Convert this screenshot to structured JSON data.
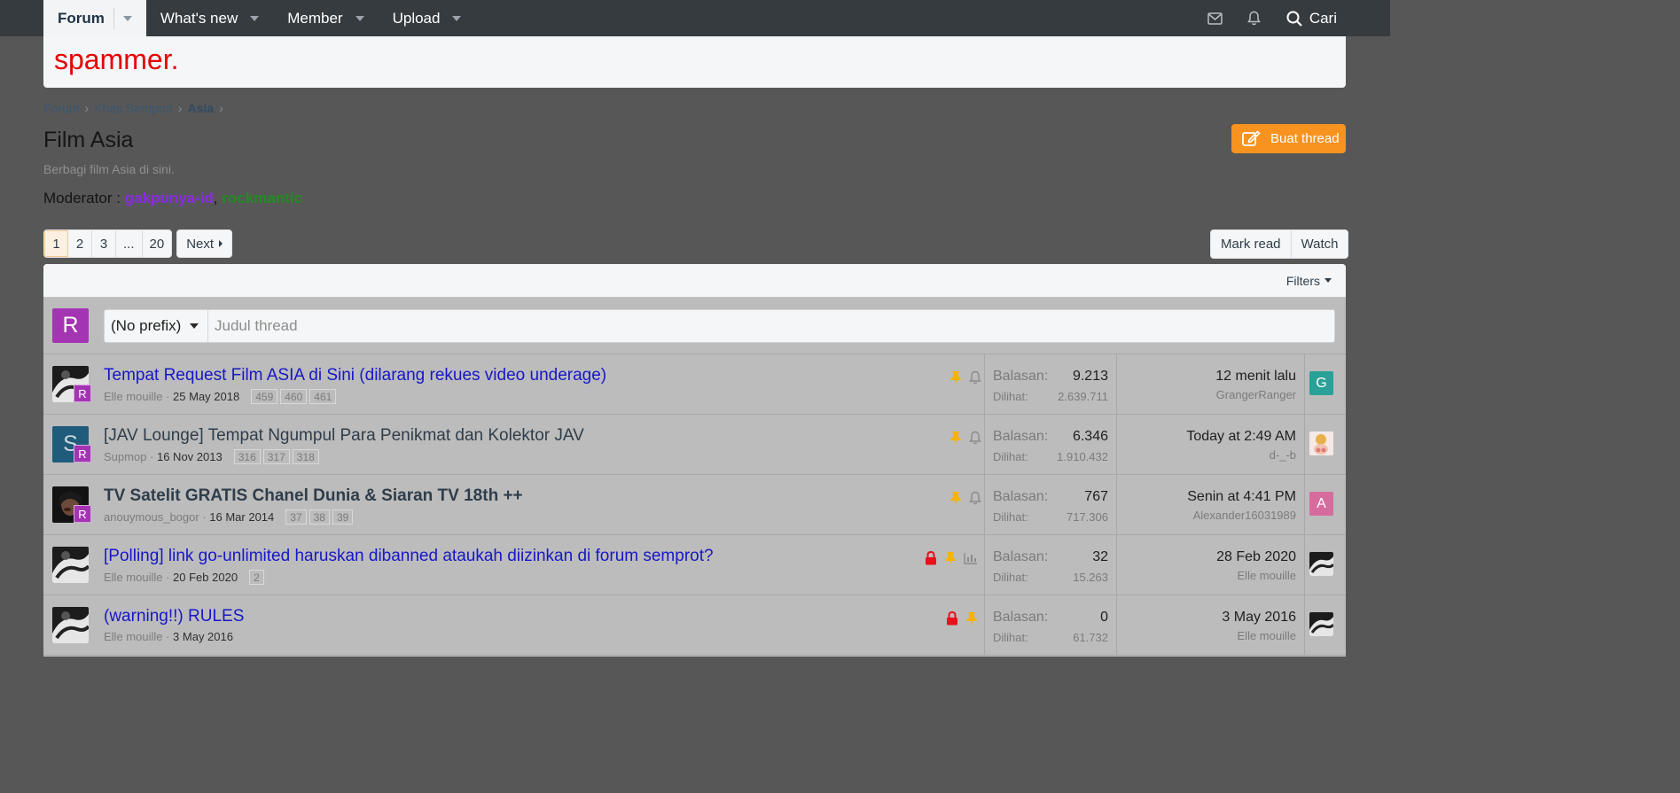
{
  "nav": {
    "tabs": [
      {
        "label": "Forum"
      },
      {
        "label": "What's new"
      },
      {
        "label": "Member"
      },
      {
        "label": "Upload"
      }
    ],
    "search_label": "Cari"
  },
  "notice": {
    "text": "spammer."
  },
  "breadcrumb": [
    "Forum",
    "Khas Semprot",
    "Asia"
  ],
  "page": {
    "title": "Film Asia",
    "description": "Berbagi film Asia di sini.",
    "moderator_label": "Moderator :",
    "moderators": [
      "gakpunya-id",
      "rockmantic"
    ],
    "create_button": "Buat thread"
  },
  "pagination": {
    "pages": [
      "1",
      "2",
      "3",
      "...",
      "20"
    ],
    "next": "Next"
  },
  "actions": {
    "mark_read": "Mark read",
    "watch": "Watch"
  },
  "filters_label": "Filters",
  "quick_thread": {
    "avatar_letter": "R",
    "prefix": "(No prefix)",
    "placeholder": "Judul thread"
  },
  "labels": {
    "replies": "Balasan:",
    "views": "Dilihat:"
  },
  "threads": [
    {
      "title": "Tempat Request Film ASIA di Sini (dilarang rekues video underage)",
      "author": "Elle mouille",
      "date": "25 May 2018",
      "pages": [
        "459",
        "460",
        "461"
      ],
      "badge": "R",
      "replies": "9.213",
      "views": "2.639.711",
      "last_when": "12 menit lalu",
      "last_user": "GrangerRanger",
      "last_avatar_letter": "G",
      "last_avatar_color": "#2aa198",
      "icons": [
        "pin-icon",
        "bell-icon"
      ]
    },
    {
      "title": "[JAV Lounge] Tempat Ngumpul Para Penikmat dan Kolektor JAV",
      "author": "Supmop",
      "date": "16 Nov 2013",
      "pages": [
        "316",
        "317",
        "318"
      ],
      "avatar_letter": "S",
      "badge": "R",
      "replies": "6.346",
      "views": "1.910.432",
      "last_when": "Today at 2:49 AM",
      "last_user": "d-_-b",
      "icons": [
        "pin-icon",
        "bell-icon"
      ]
    },
    {
      "title": "TV Satelit GRATIS Chanel Dunia & Siaran TV 18th ++",
      "author": "anouymous_bogor",
      "date": "16 Mar 2014",
      "pages": [
        "37",
        "38",
        "39"
      ],
      "badge": "R",
      "replies": "767",
      "views": "717.306",
      "last_when": "Senin at 4:41 PM",
      "last_user": "Alexander16031989",
      "last_avatar_letter": "A",
      "last_avatar_color": "#d66b9e",
      "icons": [
        "pin-icon",
        "bell-icon"
      ]
    },
    {
      "title": "[Polling] link go-unlimited haruskan dibanned ataukah diizinkan di forum semprot?",
      "author": "Elle mouille",
      "date": "20 Feb 2020",
      "pages": [
        "2"
      ],
      "replies": "32",
      "views": "15.263",
      "last_when": "28 Feb 2020",
      "last_user": "Elle mouille",
      "icons": [
        "lock-icon",
        "pin-icon",
        "poll-icon"
      ]
    },
    {
      "title": "(warning!!) RULES",
      "author": "Elle mouille",
      "date": "3 May 2016",
      "pages": [],
      "replies": "0",
      "views": "61.732",
      "last_when": "3 May 2016",
      "last_user": "Elle mouille",
      "icons": [
        "lock-icon",
        "pin-icon"
      ]
    }
  ]
}
